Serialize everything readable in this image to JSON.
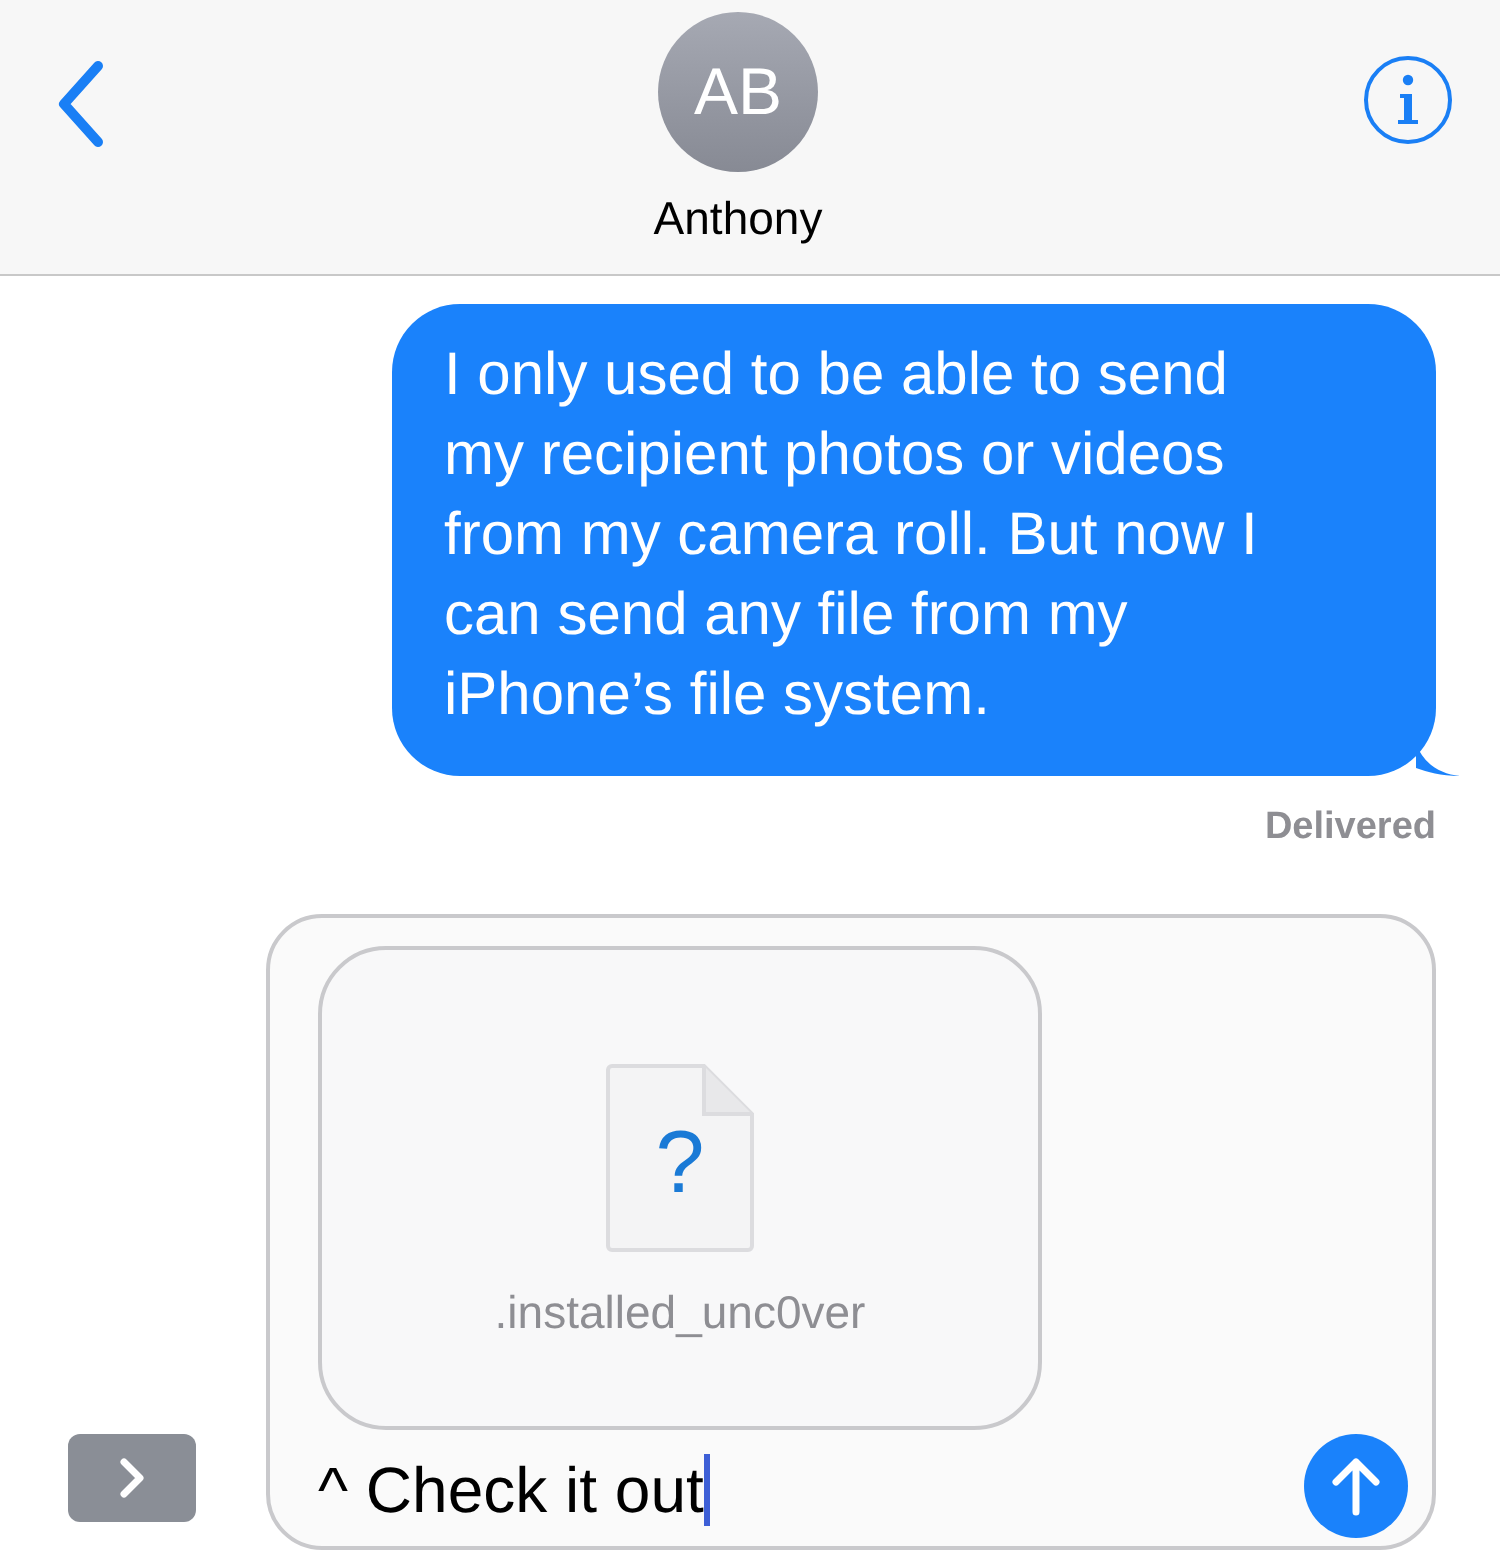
{
  "header": {
    "avatar_initials": "AB",
    "contact_name": "Anthony"
  },
  "messages": [
    {
      "kind": "outgoing",
      "text": "I only used to be able to send my recipient photos or videos from my camera roll. But now I can send any file from my iPhone’s file system.",
      "status": "Delivered"
    }
  ],
  "composer": {
    "attachment": {
      "file_glyph": "?",
      "file_name": ".installed_unc0ver"
    },
    "value": "^ Check it out"
  }
}
